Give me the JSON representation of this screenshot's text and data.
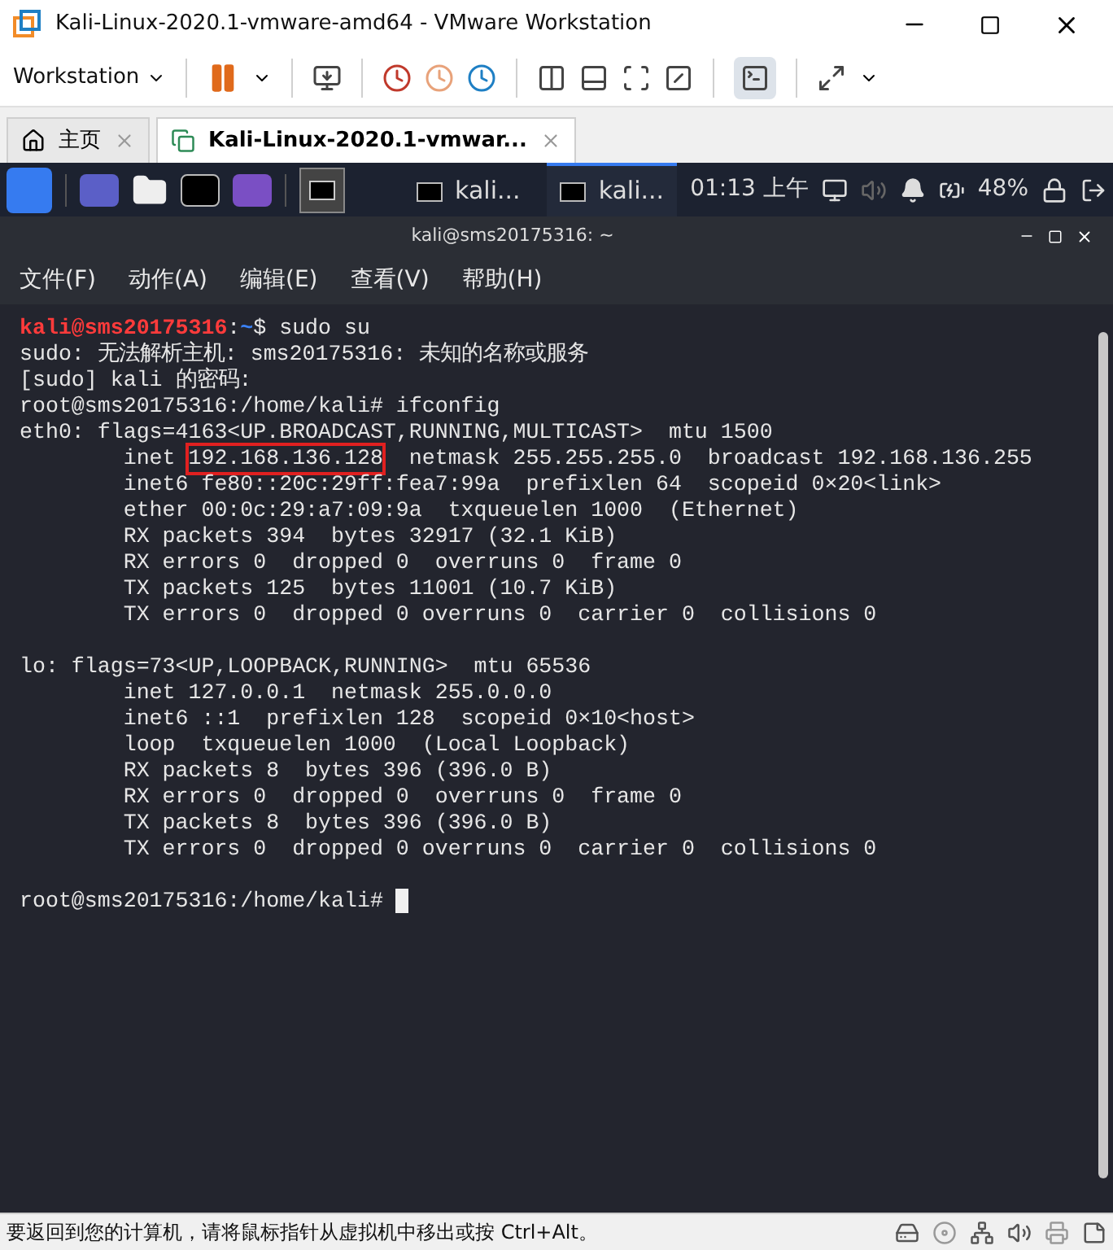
{
  "window": {
    "title": "Kali-Linux-2020.1-vmware-amd64 - VMware Workstation"
  },
  "toolbar": {
    "menu_label": "Workstation"
  },
  "tabs": [
    {
      "label": "主页",
      "kind": "home",
      "selected": false
    },
    {
      "label": "Kali-Linux-2020.1-vmwar...",
      "kind": "vm",
      "selected": true
    }
  ],
  "taskbar": {
    "tasks": [
      {
        "label": "kali...",
        "selected": false
      },
      {
        "label": "kali...",
        "selected": true
      }
    ],
    "clock": "01:13 上午",
    "battery": "48%"
  },
  "terminal": {
    "title": "kali@sms20175316: ~",
    "menu": [
      "文件(F)",
      "动作(A)",
      "编辑(E)",
      "查看(V)",
      "帮助(H)"
    ],
    "lines": [
      {
        "kind": "text",
        "segments": [
          {
            "kind": "user",
            "text": "kali@sms20175316"
          },
          {
            "kind": "plain",
            "text": ":"
          },
          {
            "kind": "path",
            "text": "~"
          },
          {
            "kind": "plain",
            "text": "$ sudo su"
          }
        ]
      },
      {
        "kind": "text",
        "segments": [
          {
            "kind": "plain",
            "text": "sudo: 无法解析主机: sms20175316: 未知的名称或服务"
          }
        ]
      },
      {
        "kind": "text",
        "segments": [
          {
            "kind": "plain",
            "text": "[sudo] kali 的密码:"
          }
        ]
      },
      {
        "kind": "text",
        "segments": [
          {
            "kind": "plain",
            "text": "root@sms20175316:/home/kali# ifconfig"
          }
        ]
      },
      {
        "kind": "text",
        "segments": [
          {
            "kind": "plain",
            "text": "eth0: flags=4163<UP.BROADCAST,RUNNING,MULTICAST>  mtu 1500"
          }
        ]
      },
      {
        "kind": "text",
        "segments": [
          {
            "kind": "plain",
            "text": "        inet "
          },
          {
            "kind": "highlight",
            "text": "192.168.136.128"
          },
          {
            "kind": "plain",
            "text": "  netmask 255.255.255.0  broadcast 192.168.136.255"
          }
        ]
      },
      {
        "kind": "text",
        "segments": [
          {
            "kind": "plain",
            "text": "        inet6 fe80::20c:29ff:fea7:99a  prefixlen 64  scopeid 0×20<link>"
          }
        ]
      },
      {
        "kind": "text",
        "segments": [
          {
            "kind": "plain",
            "text": "        ether 00:0c:29:a7:09:9a  txqueuelen 1000  (Ethernet)"
          }
        ]
      },
      {
        "kind": "text",
        "segments": [
          {
            "kind": "plain",
            "text": "        RX packets 394  bytes 32917 (32.1 KiB)"
          }
        ]
      },
      {
        "kind": "text",
        "segments": [
          {
            "kind": "plain",
            "text": "        RX errors 0  dropped 0  overruns 0  frame 0"
          }
        ]
      },
      {
        "kind": "text",
        "segments": [
          {
            "kind": "plain",
            "text": "        TX packets 125  bytes 11001 (10.7 KiB)"
          }
        ]
      },
      {
        "kind": "text",
        "segments": [
          {
            "kind": "plain",
            "text": "        TX errors 0  dropped 0 overruns 0  carrier 0  collisions 0"
          }
        ]
      },
      {
        "kind": "blank"
      },
      {
        "kind": "text",
        "segments": [
          {
            "kind": "plain",
            "text": "lo: flags=73<UP,LOOPBACK,RUNNING>  mtu 65536"
          }
        ]
      },
      {
        "kind": "text",
        "segments": [
          {
            "kind": "plain",
            "text": "        inet 127.0.0.1  netmask 255.0.0.0"
          }
        ]
      },
      {
        "kind": "text",
        "segments": [
          {
            "kind": "plain",
            "text": "        inet6 ::1  prefixlen 128  scopeid 0×10<host>"
          }
        ]
      },
      {
        "kind": "text",
        "segments": [
          {
            "kind": "plain",
            "text": "        loop  txqueuelen 1000  (Local Loopback)"
          }
        ]
      },
      {
        "kind": "text",
        "segments": [
          {
            "kind": "plain",
            "text": "        RX packets 8  bytes 396 (396.0 B)"
          }
        ]
      },
      {
        "kind": "text",
        "segments": [
          {
            "kind": "plain",
            "text": "        RX errors 0  dropped 0  overruns 0  frame 0"
          }
        ]
      },
      {
        "kind": "text",
        "segments": [
          {
            "kind": "plain",
            "text": "        TX packets 8  bytes 396 (396.0 B)"
          }
        ]
      },
      {
        "kind": "text",
        "segments": [
          {
            "kind": "plain",
            "text": "        TX errors 0  dropped 0 overruns 0  carrier 0  collisions 0"
          }
        ]
      },
      {
        "kind": "blank"
      },
      {
        "kind": "text",
        "cursor": true,
        "segments": [
          {
            "kind": "plain",
            "text": "root@sms20175316:/home/kali# "
          }
        ]
      }
    ]
  },
  "status_bar": {
    "text": "要返回到您的计算机，请将鼠标指针从虚拟机中移出或按 Ctrl+Alt。"
  }
}
